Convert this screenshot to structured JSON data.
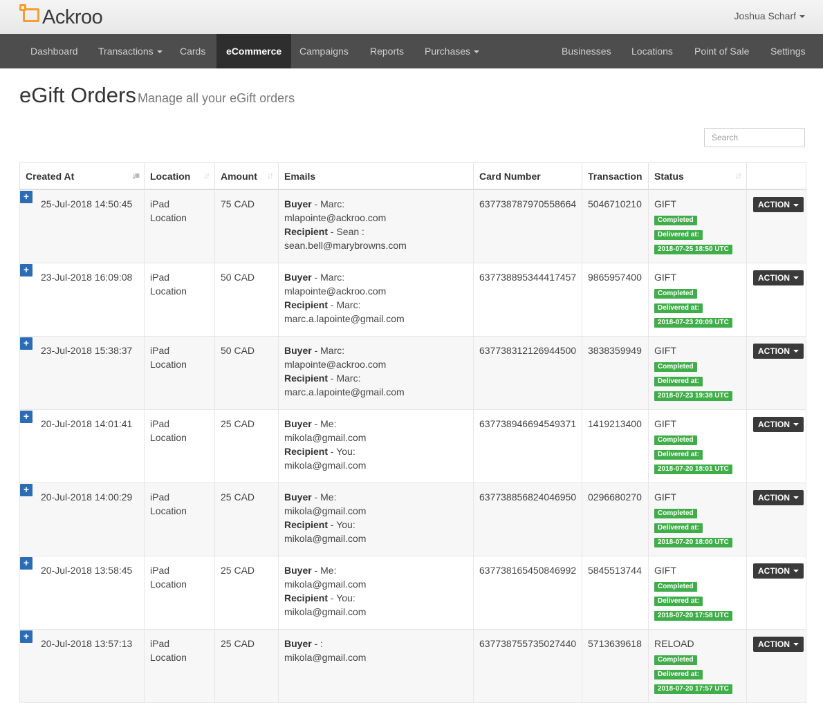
{
  "app": {
    "name": "Ackroo"
  },
  "user": {
    "name": "Joshua Scharf"
  },
  "nav": {
    "left": [
      "Dashboard",
      "Transactions",
      "Cards",
      "eCommerce",
      "Campaigns",
      "Reports",
      "Purchases"
    ],
    "right": [
      "Businesses",
      "Locations",
      "Point of Sale",
      "Settings"
    ]
  },
  "page": {
    "title": "eGift Orders",
    "subtitle": "Manage all your eGift orders"
  },
  "search": {
    "placeholder": "Search"
  },
  "table": {
    "columns": [
      "Created At",
      "Location",
      "Amount",
      "Emails",
      "Card Number",
      "Transaction",
      "Status",
      ""
    ],
    "buyer_label": "Buyer",
    "recipient_label": "Recipient",
    "completed_label": "Completed",
    "delivered_label": "Delivered at:",
    "action_label": "ACTION",
    "expand_label": "+",
    "rows": [
      {
        "created": "25-Jul-2018 14:50:45",
        "loc1": "iPad",
        "loc2": "Location",
        "amount": "75 CAD",
        "buyer": " - Marc:",
        "buyer_email": "mlapointe@ackroo.com",
        "recipient": " - Sean :",
        "recipient_email": "sean.bell@marybrowns.com",
        "card": "637738787970558664",
        "transaction": "5046710210",
        "status": "GIFT",
        "delivered": "2018-07-25 18:50 UTC"
      },
      {
        "created": "23-Jul-2018 16:09:08",
        "loc1": "iPad",
        "loc2": "Location",
        "amount": "50 CAD",
        "buyer": " - Marc:",
        "buyer_email": "mlapointe@ackroo.com",
        "recipient": " - Marc:",
        "recipient_email": "marc.a.lapointe@gmail.com",
        "card": "637738895344417457",
        "transaction": "9865957400",
        "status": "GIFT",
        "delivered": "2018-07-23 20:09 UTC"
      },
      {
        "created": "23-Jul-2018 15:38:37",
        "loc1": "iPad",
        "loc2": "Location",
        "amount": "50 CAD",
        "buyer": " - Marc:",
        "buyer_email": "mlapointe@ackroo.com",
        "recipient": " - Marc:",
        "recipient_email": "marc.a.lapointe@gmail.com",
        "card": "637738312126944500",
        "transaction": "3838359949",
        "status": "GIFT",
        "delivered": "2018-07-23 19:38 UTC"
      },
      {
        "created": "20-Jul-2018 14:01:41",
        "loc1": "iPad",
        "loc2": "Location",
        "amount": "25 CAD",
        "buyer": " - Me:",
        "buyer_email": "mikola@gmail.com",
        "recipient": " - You:",
        "recipient_email": "mikola@gmail.com",
        "card": "637738946694549371",
        "transaction": "1419213400",
        "status": "GIFT",
        "delivered": "2018-07-20 18:01 UTC"
      },
      {
        "created": "20-Jul-2018 14:00:29",
        "loc1": "iPad",
        "loc2": "Location",
        "amount": "25 CAD",
        "buyer": " - Me:",
        "buyer_email": "mikola@gmail.com",
        "recipient": " - You:",
        "recipient_email": "mikola@gmail.com",
        "card": "637738856824046950",
        "transaction": "0296680270",
        "status": "GIFT",
        "delivered": "2018-07-20 18:00 UTC"
      },
      {
        "created": "20-Jul-2018 13:58:45",
        "loc1": "iPad",
        "loc2": "Location",
        "amount": "25 CAD",
        "buyer": " - Me:",
        "buyer_email": "mikola@gmail.com",
        "recipient": " - You:",
        "recipient_email": "mikola@gmail.com",
        "card": "637738165450846992",
        "transaction": "5845513744",
        "status": "GIFT",
        "delivered": "2018-07-20 17:58 UTC"
      },
      {
        "created": "20-Jul-2018 13:57:13",
        "loc1": "iPad",
        "loc2": "Location",
        "amount": "25 CAD",
        "buyer": " - :",
        "buyer_email": "mikola@gmail.com",
        "recipient": "",
        "recipient_email": "",
        "card": "637738755735027440",
        "transaction": "5713639618",
        "status": "RELOAD",
        "delivered": "2018-07-20 17:57 UTC"
      }
    ]
  },
  "colors": {
    "nav_bg": "#4d4d4d",
    "nav_active": "#2e2e2e",
    "badge_green": "#3fae49",
    "expand_blue": "#2b6cb5",
    "logo_orange": "#f0a030"
  }
}
